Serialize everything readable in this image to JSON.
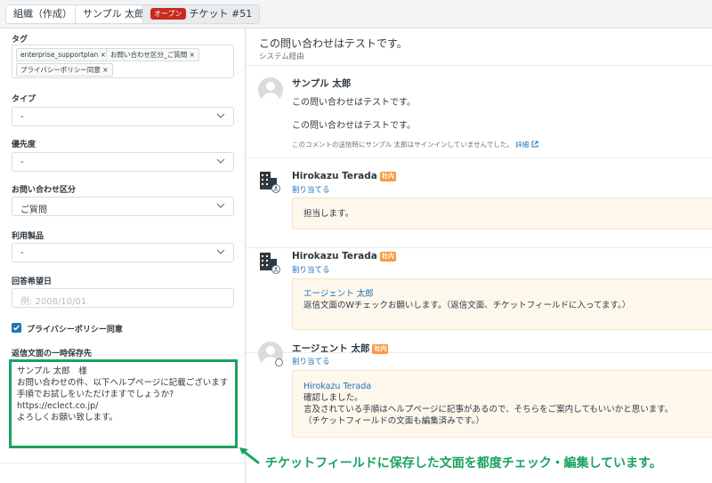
{
  "tabs": [
    {
      "label": "組織（作成）"
    },
    {
      "label": "サンプル 太郎"
    },
    {
      "status": "オープン",
      "label": "チケット #51"
    }
  ],
  "left": {
    "tags_label": "タグ",
    "tags": [
      "enterprise_supportplan",
      "お問い合わせ区分_ご質問",
      "プライバシーポリシー同意"
    ],
    "type_label": "タイプ",
    "type_value": "-",
    "priority_label": "優先度",
    "priority_value": "-",
    "category_label": "お問い合わせ区分",
    "category_value": "ご質問",
    "product_label": "利用製品",
    "product_value": "-",
    "reply_date_label": "回答希望日",
    "reply_date_placeholder": "例: 2008/10/01",
    "privacy_label": "プライバシーポリシー同意",
    "draft_label": "返信文面の一時保存先",
    "draft_lines": [
      "サンプル 太郎　様",
      "",
      "お問い合わせの件、以下ヘルプページに記載ございます",
      "手順でお試しをいただけますでしょうか?",
      "https://eclect.co.jp/",
      "",
      "よろしくお願い致します。"
    ]
  },
  "conversation": {
    "subject": "この問い合わせはテストです。",
    "via": "システム経由",
    "messages": [
      {
        "author": "サンプル 太郎",
        "lines": [
          "この問い合わせはテストです。",
          "この問い合わせはテストです。"
        ],
        "unsigned_note": "このコメントの送信時にサンプル 太郎はサインインしていませんでした。",
        "details_link": "詳細"
      },
      {
        "author": "Hirokazu Terada",
        "badge": "社内",
        "assign": "割り当てる",
        "note_lines": [
          "担当します。"
        ]
      },
      {
        "author": "Hirokazu Terada",
        "badge": "社内",
        "assign": "割り当てる",
        "mention": "エージェント 太郎",
        "note_lines": [
          "返信文面のWチェックお願いします。（返信文面、チケットフィールドに入ってます。）"
        ]
      },
      {
        "author": "エージェント 太郎",
        "badge": "社内",
        "assign": "割り当てる",
        "mention": "Hirokazu Terada",
        "note_lines": [
          "確認しました。",
          "言及されている手順はヘルプページに記事があるので、そちらをご案内してもいいかと思います。",
          "（チケットフィールドの文面も編集済みです。）"
        ]
      }
    ]
  },
  "annotation": "チケットフィールドに保存した文面を都度チェック・編集しています。",
  "colors": {
    "accent": "#1f73b7",
    "open_badge": "#c72a1c",
    "internal_badge": "#f79a3e",
    "annotation": "#1aa260",
    "note_bg": "#fdf7ec"
  }
}
